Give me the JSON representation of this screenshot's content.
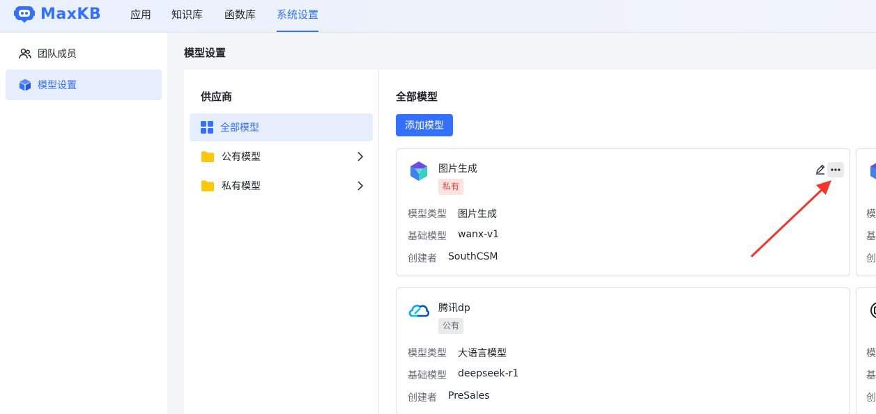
{
  "app": {
    "name": "MaxKB"
  },
  "nav": [
    {
      "label": "应用"
    },
    {
      "label": "知识库"
    },
    {
      "label": "函数库"
    },
    {
      "label": "系统设置"
    }
  ],
  "sidebar": {
    "items": [
      {
        "label": "团队成员",
        "icon": "team-icon"
      },
      {
        "label": "模型设置",
        "icon": "cube-icon"
      }
    ]
  },
  "page": {
    "title": "模型设置"
  },
  "providers": {
    "title": "供应商",
    "items": [
      {
        "label": "全部模型",
        "icon": "grid-icon"
      },
      {
        "label": "公有模型",
        "icon": "folder-icon"
      },
      {
        "label": "私有模型",
        "icon": "folder-icon"
      }
    ]
  },
  "models": {
    "title": "全部模型",
    "add_label": "添加模型",
    "field_labels": {
      "type": "模型类型",
      "base": "基础模型",
      "creator": "创建者"
    },
    "cards": [
      {
        "name": "图片生成",
        "tag": "私有",
        "type": "图片生成",
        "base": "wanx-v1",
        "creator": "SouthCSM",
        "logo": "tongyi-logo"
      },
      {
        "name": "腾讯dp",
        "tag": "公有",
        "type": "大语言模型",
        "base": "deepseek-r1",
        "creator": "PreSales",
        "logo": "tencent-cloud-logo"
      }
    ],
    "ghost_labels": [
      "模",
      "基",
      "创"
    ]
  },
  "colors": {
    "accent": "#3370ff",
    "private_tag": "#e3403f",
    "annotation_arrow": "#f5342a"
  }
}
